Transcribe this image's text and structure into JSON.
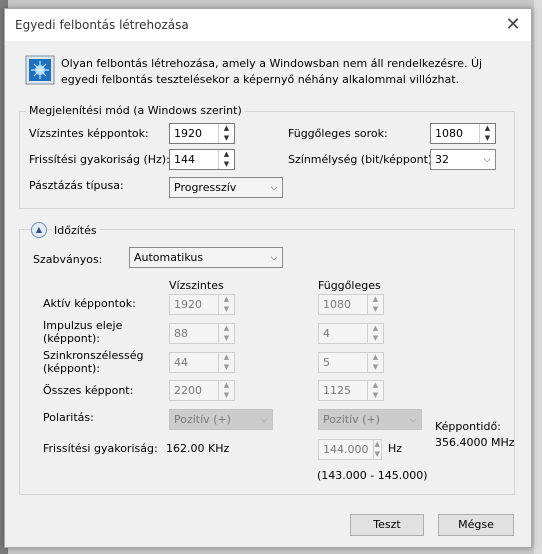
{
  "window": {
    "title": "Egyedi felbontás létrehozása",
    "close_glyph": "✕"
  },
  "intro": "Olyan felbontás létrehozása, amely a Windowsban nem áll rendelkezésre. Új egyedi felbontás tesztelésekor a képernyő néhány alkalommal villózhat.",
  "display_mode": {
    "group_label": "Megjelenítési mód (a Windows szerint)",
    "horizontal_pixels": {
      "label": "Vízszintes képpontok:",
      "value": "1920"
    },
    "vertical_lines": {
      "label": "Függőleges sorok:",
      "value": "1080"
    },
    "refresh_rate": {
      "label": "Frissítési gyakoriság (Hz):",
      "value": "144"
    },
    "color_depth": {
      "label": "Színmélység (bit/képpont):",
      "value": "32"
    },
    "scan_type": {
      "label": "Pásztázás típusa:",
      "value": "Progresszív"
    }
  },
  "timing": {
    "group_label": "Időzítés",
    "standard": {
      "label": "Szabványos:",
      "value": "Automatikus"
    },
    "col_horizontal": "Vízszintes",
    "col_vertical": "Függőleges",
    "active_pixels": {
      "label": "Aktív képpontok:",
      "h": "1920",
      "v": "1080"
    },
    "pulse_start": {
      "label_line1": "Impulzus eleje",
      "label_line2": "(képpont):",
      "h": "88",
      "v": "4"
    },
    "sync_width": {
      "label_line1": "Szinkronszélesség",
      "label_line2": "(képpont):",
      "h": "44",
      "v": "5"
    },
    "total_pixels": {
      "label": "Összes képpont:",
      "h": "2200",
      "v": "1125"
    },
    "polarity": {
      "label": "Polaritás:",
      "h": "Pozitív (+)",
      "v": "Pozitív (+)"
    },
    "refresh": {
      "label": "Frissítési gyakoriság:",
      "h_value": "162.00 KHz",
      "v_value": "144.000",
      "unit": "Hz",
      "range": "(143.000 - 145.000)"
    },
    "pixel_clock": {
      "label": "Képpontidő:",
      "value": "356.4000 MHz"
    }
  },
  "buttons": {
    "test": "Teszt",
    "cancel": "Mégse"
  },
  "icons": {
    "spin_up": "▲",
    "spin_down": "▼",
    "dropdown": "⌵",
    "collapse": "▲"
  }
}
